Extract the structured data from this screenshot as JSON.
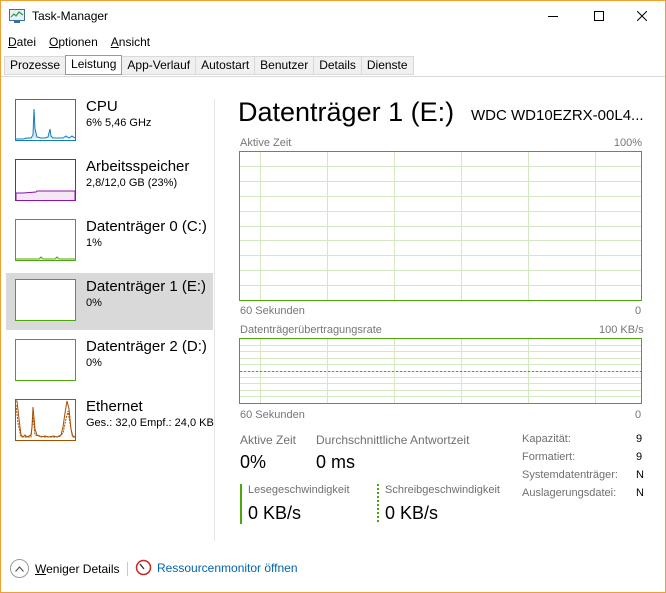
{
  "window": {
    "title": "Task-Manager",
    "icon": "task-manager-icon",
    "controls": [
      "minimize-icon",
      "maximize-icon",
      "close-icon"
    ]
  },
  "menu": [
    "Datei",
    "Optionen",
    "Ansicht"
  ],
  "tabs": [
    "Prozesse",
    "Leistung",
    "App-Verlauf",
    "Autostart",
    "Benutzer",
    "Details",
    "Dienste"
  ],
  "active_tab": "Leistung",
  "sidebar": {
    "items": [
      {
        "title": "CPU",
        "subtitle": "6%  5,46 GHz",
        "color": "#117dbb"
      },
      {
        "title": "Arbeitsspeicher",
        "subtitle": "2,8/12,0 GB (23%)",
        "color": "#8b12ae"
      },
      {
        "title": "Datenträger 0 (C:)",
        "subtitle": "1%",
        "color": "#4da60c"
      },
      {
        "title": "Datenträger 1 (E:)",
        "subtitle": "0%",
        "color": "#4da60c"
      },
      {
        "title": "Datenträger 2 (D:)",
        "subtitle": "0%",
        "color": "#4da60c"
      },
      {
        "title": "Ethernet",
        "subtitle": "Ges.: 32,0  Empf.: 24,0 KB",
        "color": "#a74f01"
      }
    ],
    "selected_index": 3
  },
  "main": {
    "title": "Datenträger 1 (E:)",
    "model": "WDC WD10EZRX-00L4...",
    "active_time_chart": {
      "label": "Aktive Zeit",
      "max_label": "100%",
      "x_left": "60 Sekunden",
      "x_right": "0"
    },
    "transfer_chart": {
      "label": "Datenträgerübertragungsrate",
      "max_label": "100 KB/s",
      "x_left": "60 Sekunden",
      "x_right": "0"
    },
    "stats": {
      "active_time_label": "Aktive Zeit",
      "active_time_value": "0%",
      "response_label": "Durchschnittliche Antwortzeit",
      "response_value": "0 ms",
      "read_label": "Lesegeschwindigkeit",
      "read_value": "0 KB/s",
      "write_label": "Schreibgeschwindigkeit",
      "write_value": "0 KB/s"
    },
    "properties": [
      {
        "label": "Kapazität:",
        "value": "9"
      },
      {
        "label": "Formatiert:",
        "value": "9"
      },
      {
        "label": "Systemdatenträger:",
        "value": "N"
      },
      {
        "label": "Auslagerungsdatei:",
        "value": "N"
      }
    ],
    "accent_color": "#4da60c"
  },
  "footer": {
    "less_details": "Weniger Details",
    "resource_monitor": "Ressourcenmonitor öffnen"
  }
}
